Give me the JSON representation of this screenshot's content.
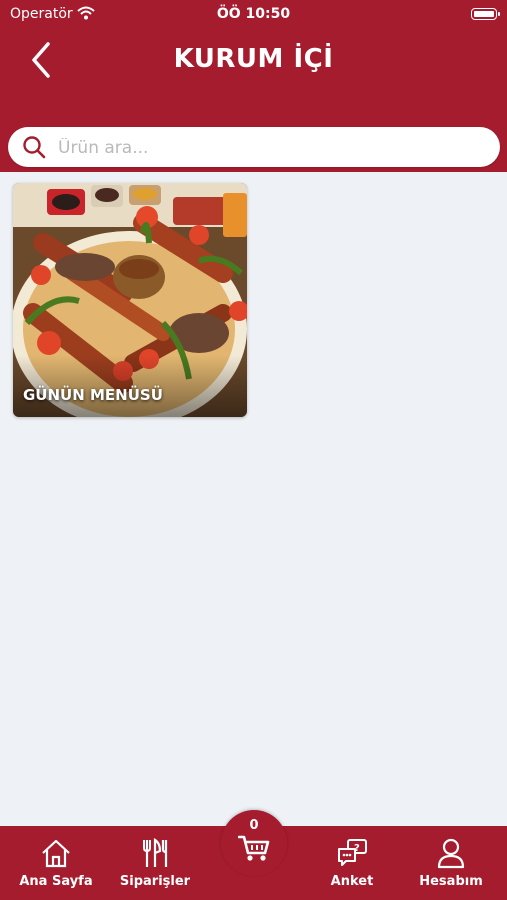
{
  "status_bar": {
    "carrier": "Operatör",
    "time": "ÖÖ 10:50"
  },
  "header": {
    "title": "KURUM İÇİ"
  },
  "search": {
    "placeholder": "Ürün ara..."
  },
  "categories": [
    {
      "label": "GÜNÜN MENÜSÜ"
    }
  ],
  "tabbar": {
    "home": "Ana Sayfa",
    "orders": "Siparişler",
    "cart_count": "0",
    "survey": "Anket",
    "account": "Hesabım"
  },
  "colors": {
    "primary": "#a51c2e",
    "background": "#eef1f5"
  }
}
